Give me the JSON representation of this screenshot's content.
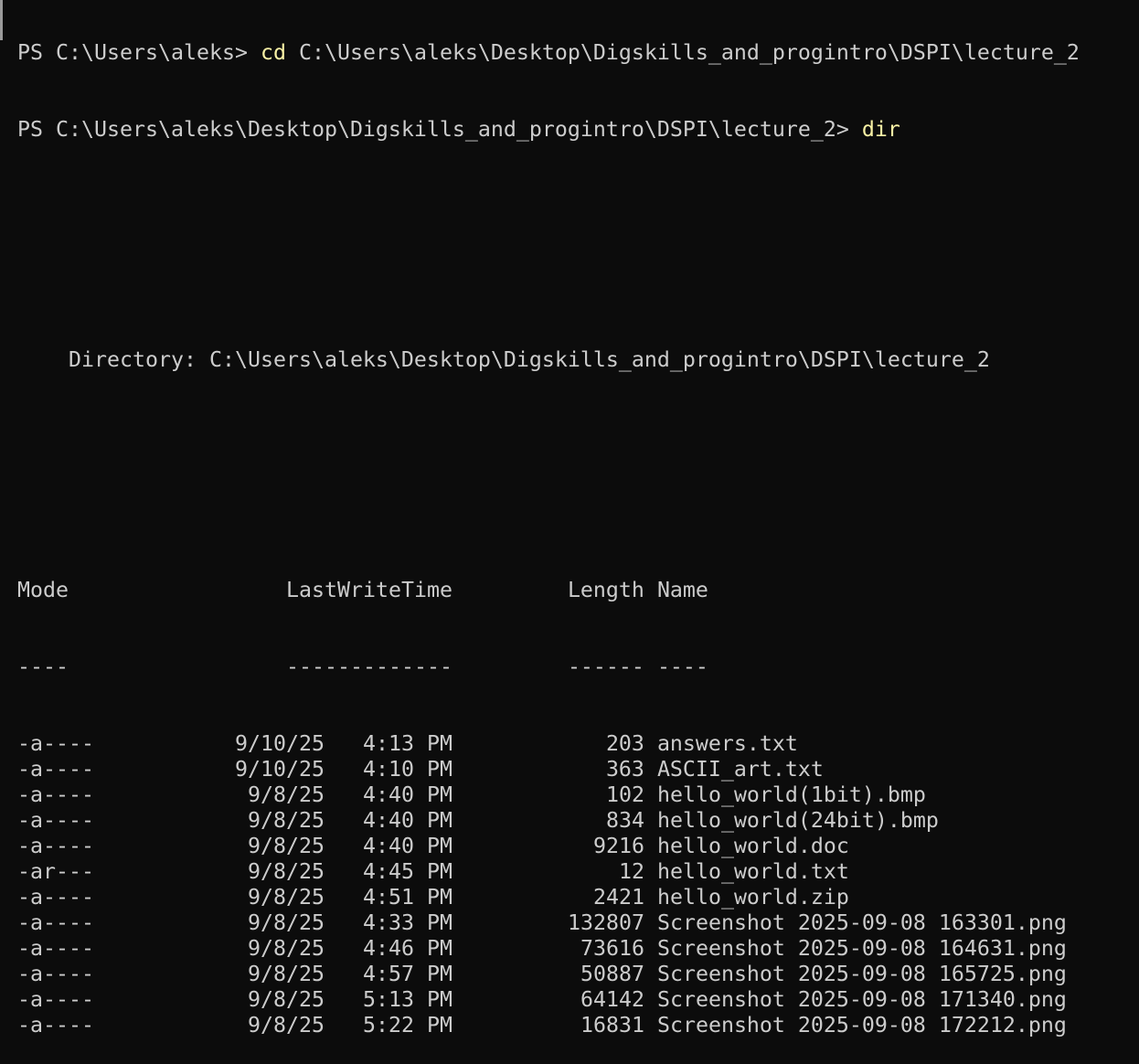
{
  "terminal": {
    "prev_prompt": "PS C:\\Users\\aleks> ",
    "prev_command": "cd",
    "prev_args": " C:\\Users\\aleks\\Desktop\\Digskills_and_progintro\\DSPI\\lecture_2",
    "prompt": "PS C:\\Users\\aleks\\Desktop\\Digskills_and_progintro\\DSPI\\lecture_2> ",
    "command": "dir",
    "directory_label": "    Directory: C:\\Users\\aleks\\Desktop\\Digskills_and_progintro\\DSPI\\lecture_2",
    "headers": {
      "mode": "Mode",
      "time": "LastWriteTime",
      "length": "Length",
      "name": "Name"
    },
    "separators": {
      "mode": "----",
      "time": "-------------",
      "length": "------",
      "name": "----"
    },
    "rows": [
      {
        "mode": "-a----",
        "date": "9/10/25",
        "time": "4:13 PM",
        "length": "203",
        "name": "answers.txt"
      },
      {
        "mode": "-a----",
        "date": "9/10/25",
        "time": "4:10 PM",
        "length": "363",
        "name": "ASCII_art.txt"
      },
      {
        "mode": "-a----",
        "date": "9/8/25",
        "time": "4:40 PM",
        "length": "102",
        "name": "hello_world(1bit).bmp"
      },
      {
        "mode": "-a----",
        "date": "9/8/25",
        "time": "4:40 PM",
        "length": "834",
        "name": "hello_world(24bit).bmp"
      },
      {
        "mode": "-a----",
        "date": "9/8/25",
        "time": "4:40 PM",
        "length": "9216",
        "name": "hello_world.doc"
      },
      {
        "mode": "-ar---",
        "date": "9/8/25",
        "time": "4:45 PM",
        "length": "12",
        "name": "hello_world.txt"
      },
      {
        "mode": "-a----",
        "date": "9/8/25",
        "time": "4:51 PM",
        "length": "2421",
        "name": "hello_world.zip"
      },
      {
        "mode": "-a----",
        "date": "9/8/25",
        "time": "4:33 PM",
        "length": "132807",
        "name": "Screenshot 2025-09-08 163301.png"
      },
      {
        "mode": "-a----",
        "date": "9/8/25",
        "time": "4:46 PM",
        "length": "73616",
        "name": "Screenshot 2025-09-08 164631.png"
      },
      {
        "mode": "-a----",
        "date": "9/8/25",
        "time": "4:57 PM",
        "length": "50887",
        "name": "Screenshot 2025-09-08 165725.png"
      },
      {
        "mode": "-a----",
        "date": "9/8/25",
        "time": "5:13 PM",
        "length": "64142",
        "name": "Screenshot 2025-09-08 171340.png"
      },
      {
        "mode": "-a----",
        "date": "9/8/25",
        "time": "5:22 PM",
        "length": "16831",
        "name": "Screenshot 2025-09-08 172212.png"
      }
    ],
    "colors": {
      "background": "#0c0c0c",
      "text": "#cccccc",
      "command": "#f9f1a5"
    }
  }
}
